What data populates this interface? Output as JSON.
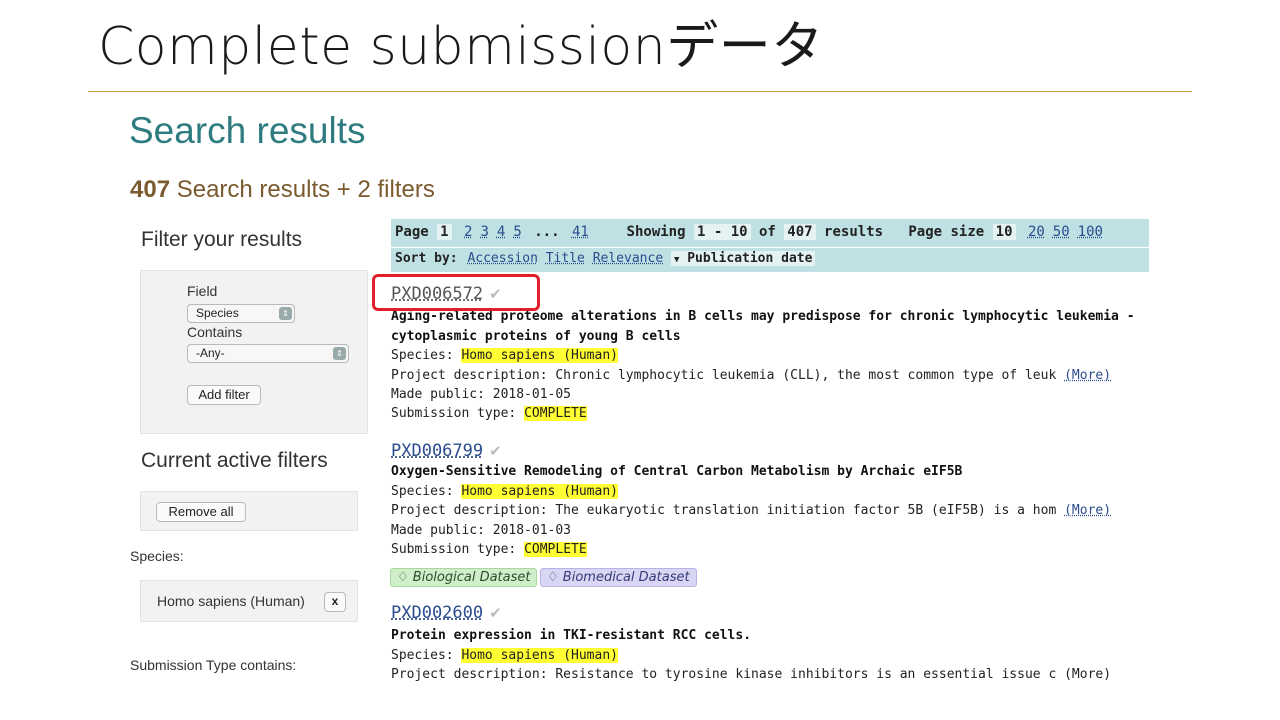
{
  "slide": {
    "title": "Complete submissionデータ"
  },
  "search": {
    "heading": "Search results",
    "count": "407",
    "count_suffix": " Search results + 2 filters"
  },
  "sidebar": {
    "filter_heading": "Filter your results",
    "field_label": "Field",
    "field_value": "Species",
    "contains_label": "Contains",
    "contains_value": "-Any-",
    "add_filter": "Add filter",
    "active_heading": "Current active filters",
    "remove_all": "Remove all",
    "species_label": "Species:",
    "species_filter": "Homo sapiens (Human)",
    "remove_x": "x",
    "submission_type_label": "Submission Type contains:"
  },
  "pager": {
    "page_label": "Page",
    "current_page": "1",
    "pages": [
      "2",
      "3",
      "4",
      "5"
    ],
    "ellipsis": "...",
    "last_page": "41",
    "showing_label": "Showing",
    "showing_range": "1 - 10",
    "of_label": "of",
    "total": "407",
    "results_label": "results",
    "size_label": "Page size",
    "current_size": "10",
    "sizes": [
      "20",
      "50",
      "100"
    ],
    "sort_label": "Sort by:",
    "sort_options": [
      "Accession",
      "Title",
      "Relevance"
    ],
    "sort_active": "Publication date"
  },
  "results": [
    {
      "accession": "PXD006572",
      "title_lines": [
        "Aging-related proteome alterations in B cells may predispose for chronic lymphocytic leukemia -",
        "cytoplasmic proteins of young B cells"
      ],
      "species_label": "Species: ",
      "species": "Homo sapiens (Human)",
      "description": "Project description: Chronic lymphocytic leukemia (CLL), the most common type of leuk",
      "more": "(More)",
      "made_public": "Made public: 2018-01-05",
      "submission_label": "Submission type: ",
      "submission_type": "COMPLETE"
    },
    {
      "accession": "PXD006799",
      "title_lines": [
        "Oxygen-Sensitive Remodeling of Central Carbon Metabolism by Archaic eIF5B"
      ],
      "species_label": "Species: ",
      "species": "Homo sapiens (Human)",
      "description": "Project description: The eukaryotic translation initiation factor 5B (eIF5B) is a hom",
      "more": "(More)",
      "made_public": "Made public: 2018-01-03",
      "submission_label": "Submission type: ",
      "submission_type": "COMPLETE",
      "tags": [
        "Biological Dataset",
        "Biomedical Dataset"
      ]
    },
    {
      "accession": "PXD002600",
      "title_lines": [
        "Protein expression in TKI-resistant RCC cells."
      ],
      "species_label": "Species: ",
      "species": "Homo sapiens (Human)",
      "description": "Project description: Resistance to tyrosine kinase inhibitors is an essential issue c",
      "more": "(More)"
    }
  ],
  "icons": {
    "check": "✔",
    "tag": "♢",
    "sort_arrow": "▼",
    "select_arrow": "⇕"
  },
  "colors": {
    "heading_teal": "#2f7c80",
    "pager_bg": "#bfe1e4",
    "highlight": "#ffff33",
    "callout_red": "#e0202a"
  }
}
